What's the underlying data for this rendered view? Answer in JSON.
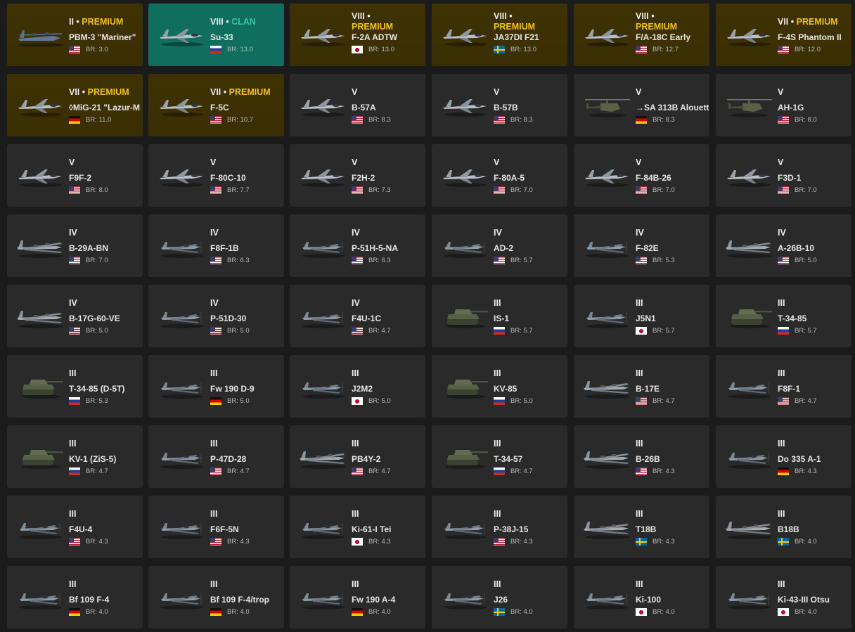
{
  "labels": {
    "br_prefix": "BR:"
  },
  "colors": {
    "card_bg": "#2a2a2a",
    "premium_bg": "#3e3203",
    "clan_bg": "#0f6e5d",
    "premium_text": "#f2c21d",
    "clan_text": "#35c9a6"
  },
  "vehicles": [
    {
      "rank": "II",
      "tag": "PREMIUM",
      "name": "PBM-3 \"Mariner\"",
      "flag": "usa",
      "br": "3.0",
      "kind": "seaplane",
      "variant": "premium"
    },
    {
      "rank": "VIII",
      "tag": "CLAN",
      "name": "Su-33",
      "flag": "russia",
      "br": "13.0",
      "kind": "jet",
      "variant": "clan"
    },
    {
      "rank": "VIII",
      "tag": "PREMIUM",
      "name": "F-2A ADTW",
      "flag": "japan",
      "br": "13.0",
      "kind": "jet",
      "variant": "premium",
      "wrap": true
    },
    {
      "rank": "VIII",
      "tag": "PREMIUM",
      "name": "JA37DI F21",
      "flag": "sweden",
      "br": "13.0",
      "kind": "jet",
      "variant": "premium",
      "wrap": true
    },
    {
      "rank": "VIII",
      "tag": "PREMIUM",
      "name": "F/A-18C Early",
      "flag": "usa",
      "br": "12.7",
      "kind": "jet",
      "variant": "premium",
      "wrap": true
    },
    {
      "rank": "VII",
      "tag": "PREMIUM",
      "name": "F-4S Phantom II",
      "flag": "usa",
      "br": "12.0",
      "kind": "jet",
      "variant": "premium"
    },
    {
      "rank": "VII",
      "tag": "PREMIUM",
      "name": "◊MiG-21 \"Lazur-M",
      "flag": "germany",
      "br": "11.0",
      "kind": "jet",
      "variant": "premium"
    },
    {
      "rank": "VII",
      "tag": "PREMIUM",
      "name": "F-5C",
      "flag": "usa",
      "br": "10.7",
      "kind": "jet",
      "variant": "premium"
    },
    {
      "rank": "V",
      "tag": "",
      "name": "B-57A",
      "flag": "usa",
      "br": "8.3",
      "kind": "jet",
      "variant": "normal"
    },
    {
      "rank": "V",
      "tag": "",
      "name": "B-57B",
      "flag": "usa",
      "br": "8.3",
      "kind": "jet",
      "variant": "normal"
    },
    {
      "rank": "V",
      "tag": "",
      "name": "→SA 313B Alouett",
      "flag": "germany",
      "br": "8.3",
      "kind": "heli",
      "variant": "normal"
    },
    {
      "rank": "V",
      "tag": "",
      "name": "AH-1G",
      "flag": "usa",
      "br": "8.0",
      "kind": "heli",
      "variant": "normal"
    },
    {
      "rank": "V",
      "tag": "",
      "name": "F9F-2",
      "flag": "usa",
      "br": "8.0",
      "kind": "jet",
      "variant": "normal"
    },
    {
      "rank": "V",
      "tag": "",
      "name": "F-80C-10",
      "flag": "usa",
      "br": "7.7",
      "kind": "jet",
      "variant": "normal"
    },
    {
      "rank": "V",
      "tag": "",
      "name": "F2H-2",
      "flag": "usa",
      "br": "7.3",
      "kind": "jet",
      "variant": "normal"
    },
    {
      "rank": "V",
      "tag": "",
      "name": "F-80A-5",
      "flag": "usa",
      "br": "7.0",
      "kind": "jet",
      "variant": "normal"
    },
    {
      "rank": "V",
      "tag": "",
      "name": "F-84B-26",
      "flag": "usa",
      "br": "7.0",
      "kind": "jet",
      "variant": "normal"
    },
    {
      "rank": "V",
      "tag": "",
      "name": "F3D-1",
      "flag": "usa",
      "br": "7.0",
      "kind": "jet",
      "variant": "normal"
    },
    {
      "rank": "IV",
      "tag": "",
      "name": "B-29A-BN",
      "flag": "usa",
      "br": "7.0",
      "kind": "bomber",
      "variant": "normal"
    },
    {
      "rank": "IV",
      "tag": "",
      "name": "F8F-1B",
      "flag": "usa",
      "br": "6.3",
      "kind": "prop",
      "variant": "normal"
    },
    {
      "rank": "IV",
      "tag": "",
      "name": "P-51H-5-NA",
      "flag": "usa",
      "br": "6.3",
      "kind": "prop",
      "variant": "normal"
    },
    {
      "rank": "IV",
      "tag": "",
      "name": "AD-2",
      "flag": "usa",
      "br": "5.7",
      "kind": "prop",
      "variant": "normal"
    },
    {
      "rank": "IV",
      "tag": "",
      "name": "F-82E",
      "flag": "usa",
      "br": "5.3",
      "kind": "prop",
      "variant": "normal"
    },
    {
      "rank": "IV",
      "tag": "",
      "name": "A-26B-10",
      "flag": "usa",
      "br": "5.0",
      "kind": "bomber",
      "variant": "normal"
    },
    {
      "rank": "IV",
      "tag": "",
      "name": "B-17G-60-VE",
      "flag": "usa",
      "br": "5.0",
      "kind": "bomber",
      "variant": "normal"
    },
    {
      "rank": "IV",
      "tag": "",
      "name": "P-51D-30",
      "flag": "usa",
      "br": "5.0",
      "kind": "prop",
      "variant": "normal"
    },
    {
      "rank": "IV",
      "tag": "",
      "name": "F4U-1C",
      "flag": "usa",
      "br": "4.7",
      "kind": "prop",
      "variant": "normal"
    },
    {
      "rank": "III",
      "tag": "",
      "name": "IS-1",
      "flag": "russia",
      "br": "5.7",
      "kind": "tank",
      "variant": "normal"
    },
    {
      "rank": "III",
      "tag": "",
      "name": "J5N1",
      "flag": "japan",
      "br": "5.7",
      "kind": "prop",
      "variant": "normal"
    },
    {
      "rank": "III",
      "tag": "",
      "name": "T-34-85",
      "flag": "russia",
      "br": "5.7",
      "kind": "tank",
      "variant": "normal"
    },
    {
      "rank": "III",
      "tag": "",
      "name": "T-34-85 (D-5T)",
      "flag": "russia",
      "br": "5.3",
      "kind": "tank",
      "variant": "normal"
    },
    {
      "rank": "III",
      "tag": "",
      "name": "Fw 190 D-9",
      "flag": "germany",
      "br": "5.0",
      "kind": "prop",
      "variant": "normal"
    },
    {
      "rank": "III",
      "tag": "",
      "name": "J2M2",
      "flag": "japan",
      "br": "5.0",
      "kind": "prop",
      "variant": "normal"
    },
    {
      "rank": "III",
      "tag": "",
      "name": "KV-85",
      "flag": "russia",
      "br": "5.0",
      "kind": "tank",
      "variant": "normal"
    },
    {
      "rank": "III",
      "tag": "",
      "name": "B-17E",
      "flag": "usa",
      "br": "4.7",
      "kind": "bomber",
      "variant": "normal"
    },
    {
      "rank": "III",
      "tag": "",
      "name": "F8F-1",
      "flag": "usa",
      "br": "4.7",
      "kind": "prop",
      "variant": "normal"
    },
    {
      "rank": "III",
      "tag": "",
      "name": "KV-1 (ZiS-5)",
      "flag": "russia",
      "br": "4.7",
      "kind": "tank",
      "variant": "normal"
    },
    {
      "rank": "III",
      "tag": "",
      "name": "P-47D-28",
      "flag": "usa",
      "br": "4.7",
      "kind": "prop",
      "variant": "normal"
    },
    {
      "rank": "III",
      "tag": "",
      "name": "PB4Y-2",
      "flag": "usa",
      "br": "4.7",
      "kind": "bomber",
      "variant": "normal"
    },
    {
      "rank": "III",
      "tag": "",
      "name": "T-34-57",
      "flag": "russia",
      "br": "4.7",
      "kind": "tank",
      "variant": "normal"
    },
    {
      "rank": "III",
      "tag": "",
      "name": "B-26B",
      "flag": "usa",
      "br": "4.3",
      "kind": "bomber",
      "variant": "normal"
    },
    {
      "rank": "III",
      "tag": "",
      "name": "Do 335 A-1",
      "flag": "germany",
      "br": "4.3",
      "kind": "prop",
      "variant": "normal"
    },
    {
      "rank": "III",
      "tag": "",
      "name": "F4U-4",
      "flag": "usa",
      "br": "4.3",
      "kind": "prop",
      "variant": "normal"
    },
    {
      "rank": "III",
      "tag": "",
      "name": "F6F-5N",
      "flag": "usa",
      "br": "4.3",
      "kind": "prop",
      "variant": "normal"
    },
    {
      "rank": "III",
      "tag": "",
      "name": "Ki-61-I Tei",
      "flag": "japan",
      "br": "4.3",
      "kind": "prop",
      "variant": "normal"
    },
    {
      "rank": "III",
      "tag": "",
      "name": "P-38J-15",
      "flag": "usa",
      "br": "4.3",
      "kind": "prop",
      "variant": "normal"
    },
    {
      "rank": "III",
      "tag": "",
      "name": "T18B",
      "flag": "sweden",
      "br": "4.3",
      "kind": "bomber",
      "variant": "normal"
    },
    {
      "rank": "III",
      "tag": "",
      "name": "B18B",
      "flag": "sweden",
      "br": "4.0",
      "kind": "bomber",
      "variant": "normal"
    },
    {
      "rank": "III",
      "tag": "",
      "name": "Bf 109 F-4",
      "flag": "germany",
      "br": "4.0",
      "kind": "prop",
      "variant": "normal"
    },
    {
      "rank": "III",
      "tag": "",
      "name": "Bf 109 F-4/trop",
      "flag": "germany",
      "br": "4.0",
      "kind": "prop",
      "variant": "normal"
    },
    {
      "rank": "III",
      "tag": "",
      "name": "Fw 190 A-4",
      "flag": "germany",
      "br": "4.0",
      "kind": "prop",
      "variant": "normal"
    },
    {
      "rank": "III",
      "tag": "",
      "name": "J26",
      "flag": "sweden",
      "br": "4.0",
      "kind": "prop",
      "variant": "normal"
    },
    {
      "rank": "III",
      "tag": "",
      "name": "Ki-100",
      "flag": "japan",
      "br": "4.0",
      "kind": "prop",
      "variant": "normal"
    },
    {
      "rank": "III",
      "tag": "",
      "name": "Ki-43-III Otsu",
      "flag": "japan",
      "br": "4.0",
      "kind": "prop",
      "variant": "normal"
    }
  ]
}
